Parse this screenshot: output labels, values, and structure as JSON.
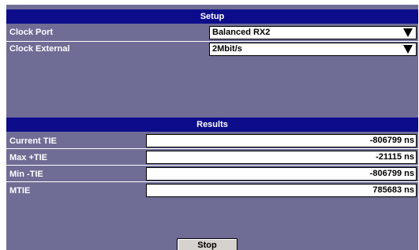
{
  "setup": {
    "title": "Setup",
    "clock_port": {
      "label": "Clock Port",
      "value": "Balanced RX2"
    },
    "clock_external": {
      "label": "Clock External",
      "value": "2Mbit/s"
    }
  },
  "results": {
    "title": "Results",
    "rows": [
      {
        "label": "Current TIE",
        "value": "-806799 ns"
      },
      {
        "label": "Max +TIE",
        "value": "-21115 ns"
      },
      {
        "label": "Min -TIE",
        "value": "-806799 ns"
      },
      {
        "label": "MTIE",
        "value": "785683 ns"
      }
    ]
  },
  "actions": {
    "stop_label": "Stop"
  },
  "colors": {
    "panel_background": "#6f6c95",
    "header_background": "#0d0d8c",
    "field_background": "#ffffff",
    "button_background": "#d6d3ce"
  },
  "icons": {
    "dropdown": "triangle-down-icon"
  }
}
